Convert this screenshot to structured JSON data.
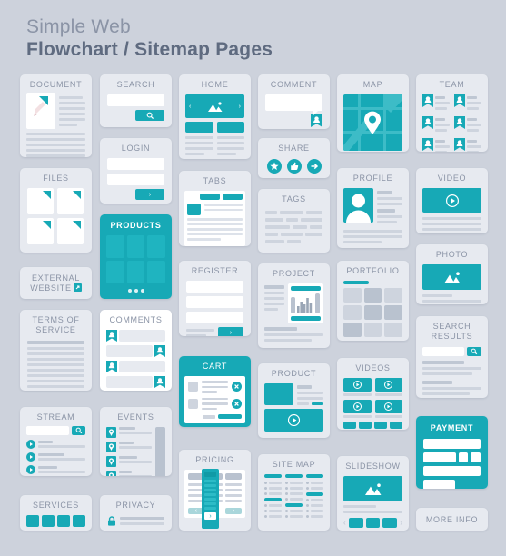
{
  "header": {
    "line1": "Simple Web",
    "line2": "Flowchart / Sitemap Pages"
  },
  "colors": {
    "background": "#cdd2dc",
    "card": "#e7eaf0",
    "accent_teal": "#17a9b6",
    "accent_teal_dark": "#0d8c99",
    "title_text": "#8b94a6",
    "heading_text": "#5f6b80",
    "line_gray": "#ced4de",
    "white": "#ffffff"
  },
  "cards": [
    {
      "id": "document",
      "label": "DOCUMENT",
      "col": 1,
      "style": "light",
      "icons": [
        "page-icon",
        "pencil-icon"
      ]
    },
    {
      "id": "files",
      "label": "FILES",
      "col": 1,
      "style": "light",
      "icons": [
        "file-icon"
      ]
    },
    {
      "id": "external-website",
      "label": "EXTERNAL WEBSITE",
      "col": 1,
      "style": "light",
      "icons": [
        "external-link-icon"
      ]
    },
    {
      "id": "terms-of-service",
      "label": "TERMS OF SERVICE",
      "col": 1,
      "style": "light",
      "icons": []
    },
    {
      "id": "stream",
      "label": "STREAM",
      "col": 1,
      "style": "light",
      "icons": [
        "search-icon",
        "play-icon"
      ]
    },
    {
      "id": "services",
      "label": "SERVICES",
      "col": 1,
      "style": "light",
      "icons": []
    },
    {
      "id": "search",
      "label": "SEARCH",
      "col": 2,
      "style": "light",
      "icons": [
        "search-icon"
      ]
    },
    {
      "id": "login",
      "label": "LOGIN",
      "col": 2,
      "style": "light",
      "icons": [
        "chevron-right-icon"
      ]
    },
    {
      "id": "products",
      "label": "PRODUCTS",
      "col": 2,
      "style": "teal",
      "icons": [
        "ellipsis-icon"
      ]
    },
    {
      "id": "comments",
      "label": "COMMENTS",
      "col": 2,
      "style": "light",
      "icons": [
        "user-tag-icon"
      ]
    },
    {
      "id": "events",
      "label": "EVENTS",
      "col": 2,
      "style": "light",
      "icons": [
        "pin-icon"
      ]
    },
    {
      "id": "privacy",
      "label": "PRIVACY",
      "col": 2,
      "style": "light",
      "icons": [
        "lock-icon"
      ]
    },
    {
      "id": "home",
      "label": "HOME",
      "col": 3,
      "style": "light",
      "icons": [
        "image-icon",
        "chevron-left-icon",
        "chevron-right-icon"
      ]
    },
    {
      "id": "tabs",
      "label": "TABS",
      "col": 3,
      "style": "light",
      "icons": []
    },
    {
      "id": "register",
      "label": "REGISTER",
      "col": 3,
      "style": "light",
      "icons": [
        "chevron-right-icon"
      ]
    },
    {
      "id": "cart",
      "label": "CART",
      "col": 3,
      "style": "teal",
      "icons": [
        "close-circle-icon"
      ]
    },
    {
      "id": "pricing",
      "label": "PRICING",
      "col": 3,
      "style": "light",
      "icons": [
        "chevron-right-icon",
        "chevron-left-icon"
      ]
    },
    {
      "id": "comment",
      "label": "COMMENT",
      "col": 4,
      "style": "light",
      "icons": [
        "user-tag-icon"
      ]
    },
    {
      "id": "share",
      "label": "SHARE",
      "col": 4,
      "style": "light",
      "icons": [
        "star-icon",
        "thumbs-up-icon",
        "arrow-right-icon"
      ]
    },
    {
      "id": "tags",
      "label": "TAGS",
      "col": 4,
      "style": "light",
      "icons": []
    },
    {
      "id": "project",
      "label": "PROJECT",
      "col": 4,
      "style": "light",
      "icons": [
        "bar-chart-icon"
      ]
    },
    {
      "id": "product",
      "label": "PRODUCT",
      "col": 4,
      "style": "light",
      "icons": [
        "play-icon"
      ]
    },
    {
      "id": "site-map",
      "label": "SITE MAP",
      "col": 4,
      "style": "light",
      "icons": []
    },
    {
      "id": "map",
      "label": "MAP",
      "col": 5,
      "style": "light",
      "icons": [
        "pin-icon"
      ]
    },
    {
      "id": "profile",
      "label": "PROFILE",
      "col": 5,
      "style": "light",
      "icons": [
        "user-icon"
      ]
    },
    {
      "id": "portfolio",
      "label": "PORTFOLIO",
      "col": 5,
      "style": "light",
      "icons": [
        "ellipsis-icon"
      ]
    },
    {
      "id": "videos",
      "label": "VIDEOS",
      "col": 5,
      "style": "light",
      "icons": [
        "play-icon"
      ]
    },
    {
      "id": "slideshow",
      "label": "SLIDESHOW",
      "col": 5,
      "style": "light",
      "icons": [
        "image-icon",
        "chevron-left-icon",
        "chevron-right-icon"
      ]
    },
    {
      "id": "team",
      "label": "TEAM",
      "col": 6,
      "style": "light",
      "icons": [
        "user-tag-icon"
      ]
    },
    {
      "id": "video",
      "label": "VIDEO",
      "col": 6,
      "style": "light",
      "icons": [
        "play-icon"
      ]
    },
    {
      "id": "photo",
      "label": "PHOTO",
      "col": 6,
      "style": "light",
      "icons": [
        "image-icon"
      ]
    },
    {
      "id": "search-results",
      "label": "SEARCH RESULTS",
      "col": 6,
      "style": "light",
      "icons": [
        "search-icon"
      ]
    },
    {
      "id": "payment",
      "label": "PAYMENT",
      "col": 6,
      "style": "teal",
      "icons": [
        "chevron-right-icon"
      ]
    },
    {
      "id": "more-info",
      "label": "MORE INFO",
      "col": 6,
      "style": "light",
      "icons": []
    }
  ],
  "labels": {
    "document": "DOCUMENT",
    "files": "FILES",
    "external_website_1": "EXTERNAL",
    "external_website_2": "WEBSITE",
    "terms_1": "TERMS OF",
    "terms_2": "SERVICE",
    "stream": "STREAM",
    "services": "SERVICES",
    "search": "SEARCH",
    "login": "LOGIN",
    "products": "PRODUCTS",
    "comments": "COMMENTS",
    "events": "EVENTS",
    "privacy": "PRIVACY",
    "home": "HOME",
    "tabs": "TABS",
    "register": "REGISTER",
    "cart": "CART",
    "pricing": "PRICING",
    "comment": "COMMENT",
    "share": "SHARE",
    "tags": "TAGS",
    "project": "PROJECT",
    "product": "PRODUCT",
    "site_map": "SITE MAP",
    "map": "MAP",
    "profile": "PROFILE",
    "portfolio": "PORTFOLIO",
    "videos": "VIDEOS",
    "slideshow": "SLIDESHOW",
    "team": "TEAM",
    "video": "VIDEO",
    "photo": "PHOTO",
    "search_results_1": "SEARCH",
    "search_results_2": "RESULTS",
    "payment": "PAYMENT",
    "more_info": "MORE INFO"
  },
  "glyphs": {
    "chevron_right": "›",
    "chevron_left": "‹",
    "arrow_right": "→"
  }
}
